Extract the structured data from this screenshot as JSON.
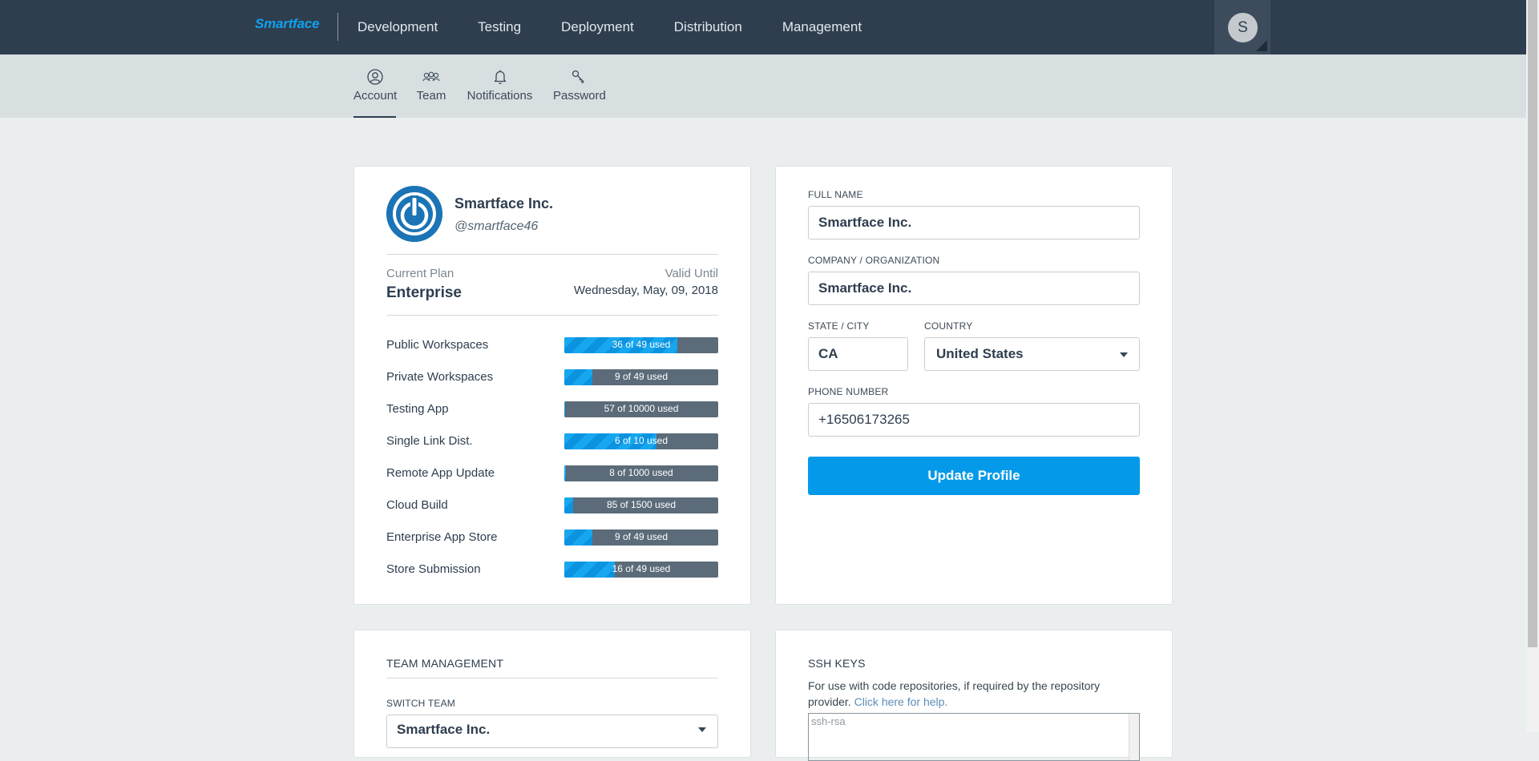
{
  "app": {
    "logo": "Smartface"
  },
  "topnav": {
    "items": [
      {
        "label": "Development"
      },
      {
        "label": "Testing"
      },
      {
        "label": "Deployment"
      },
      {
        "label": "Distribution"
      },
      {
        "label": "Management"
      }
    ],
    "avatar_initial": "S"
  },
  "subnav": {
    "items": [
      {
        "label": "Account",
        "icon": "user-circle-icon",
        "active": true
      },
      {
        "label": "Team",
        "icon": "team-icon"
      },
      {
        "label": "Notifications",
        "icon": "bell-icon"
      },
      {
        "label": "Password",
        "icon": "key-icon"
      }
    ]
  },
  "profile_summary": {
    "name": "Smartface Inc.",
    "handle": "@smartface46",
    "plan_label": "Current Plan",
    "plan": "Enterprise",
    "valid_label": "Valid Until",
    "valid_until": "Wednesday, May, 09, 2018",
    "usage": [
      {
        "label": "Public Workspaces",
        "used": 36,
        "total": 49,
        "text": "36 of 49 used"
      },
      {
        "label": "Private Workspaces",
        "used": 9,
        "total": 49,
        "text": "9 of 49 used"
      },
      {
        "label": "Testing App",
        "used": 57,
        "total": 10000,
        "text": "57 of 10000 used"
      },
      {
        "label": "Single Link Dist.",
        "used": 6,
        "total": 10,
        "text": "6 of 10 used"
      },
      {
        "label": "Remote App Update",
        "used": 8,
        "total": 1000,
        "text": "8 of 1000 used"
      },
      {
        "label": "Cloud Build",
        "used": 85,
        "total": 1500,
        "text": "85 of 1500 used"
      },
      {
        "label": "Enterprise App Store",
        "used": 9,
        "total": 49,
        "text": "9 of 49 used"
      },
      {
        "label": "Store Submission",
        "used": 16,
        "total": 49,
        "text": "16 of 49 used"
      }
    ]
  },
  "profile_form": {
    "full_name_label": "FULL NAME",
    "full_name": "Smartface Inc.",
    "company_label": "COMPANY / ORGANIZATION",
    "company": "Smartface Inc.",
    "state_label": "STATE / CITY",
    "state": "CA",
    "country_label": "COUNTRY",
    "country": "United States",
    "phone_label": "PHONE NUMBER",
    "phone": "+16506173265",
    "update_button": "Update Profile"
  },
  "team_management": {
    "title": "TEAM MANAGEMENT",
    "switch_label": "SWITCH TEAM",
    "selected_team": "Smartface Inc."
  },
  "ssh_keys": {
    "title": "SSH KEYS",
    "description": "For use with code repositories, if required by the repository provider.",
    "help_link": "Click here for help.",
    "placeholder": "ssh-rsa"
  },
  "colors": {
    "topbar": "#2e3e4f",
    "accent": "#049ae9",
    "logo": "#10a2ee"
  }
}
